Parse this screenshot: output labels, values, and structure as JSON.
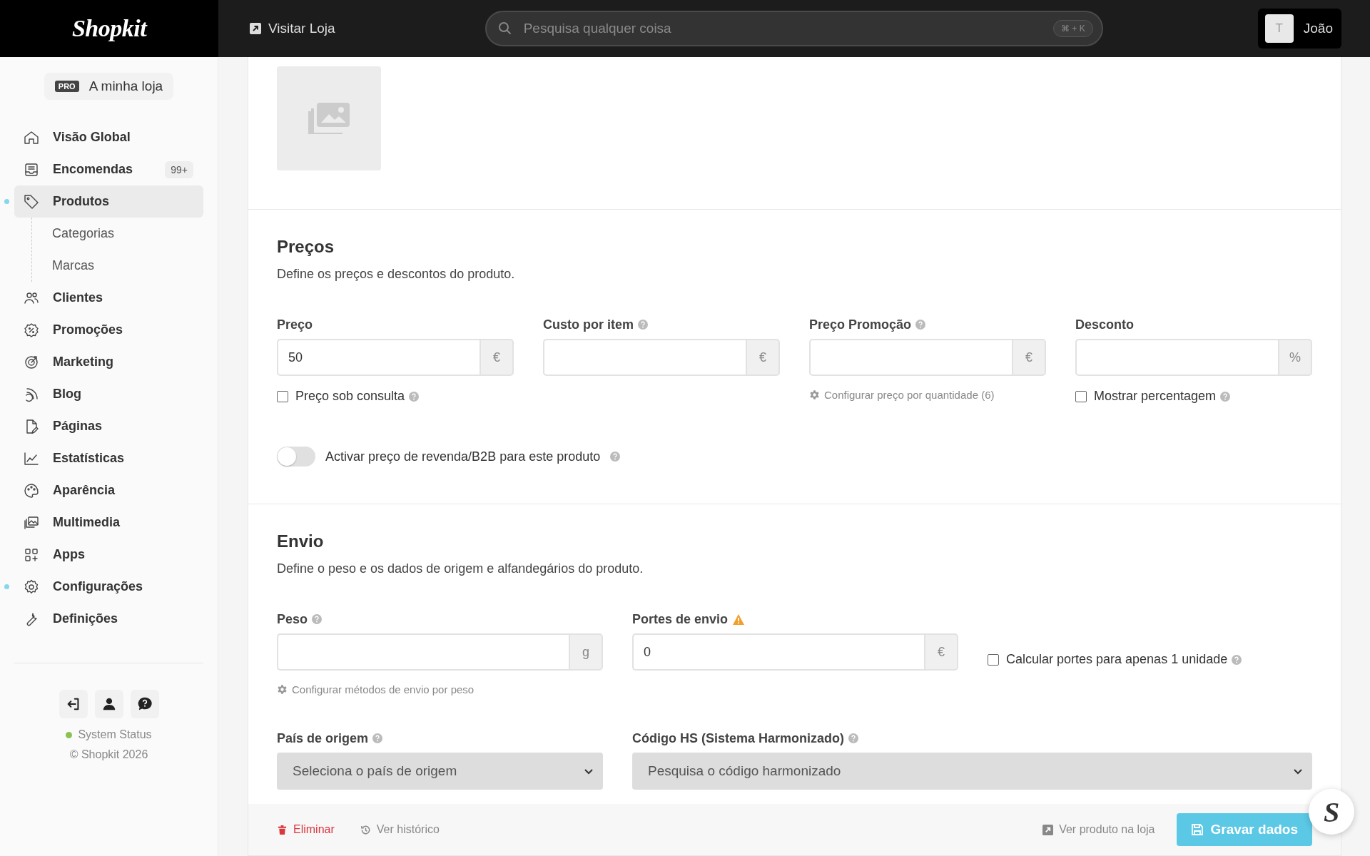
{
  "topbar": {
    "logo": "Shopkit",
    "visit_link": "Visitar Loja",
    "search": {
      "placeholder": "Pesquisa qualquer coisa",
      "shortcut": "⌘ + K"
    },
    "user": {
      "initial": "T",
      "name": "João"
    }
  },
  "sidebar": {
    "store": {
      "badge": "PRO",
      "name": "A minha loja"
    },
    "items": [
      {
        "label": "Visão Global",
        "selected": false,
        "dot": false
      },
      {
        "label": "Encomendas",
        "selected": false,
        "dot": false,
        "badge": "99+"
      },
      {
        "label": "Produtos",
        "selected": true,
        "dot": true,
        "children": [
          {
            "label": "Categorias",
            "selected": false
          },
          {
            "label": "Marcas",
            "selected": false
          }
        ]
      },
      {
        "label": "Clientes",
        "selected": false,
        "dot": false
      },
      {
        "label": "Promoções",
        "selected": false,
        "dot": false
      },
      {
        "label": "Marketing",
        "selected": false,
        "dot": false
      },
      {
        "label": "Blog",
        "selected": false,
        "dot": false
      },
      {
        "label": "Páginas",
        "selected": false,
        "dot": false
      },
      {
        "label": "Estatísticas",
        "selected": false,
        "dot": false
      },
      {
        "label": "Aparência",
        "selected": false,
        "dot": false
      },
      {
        "label": "Multimedia",
        "selected": false,
        "dot": false
      },
      {
        "label": "Apps",
        "selected": false,
        "dot": false
      },
      {
        "label": "Configurações",
        "selected": false,
        "dot": true
      },
      {
        "label": "Definições",
        "selected": false,
        "dot": false
      }
    ],
    "status": {
      "label": "System Status",
      "color": "#8cc152"
    },
    "copyright": "© Shopkit 2026"
  },
  "pricing": {
    "title": "Preços",
    "description": "Define os preços e descontos do produto.",
    "fields": [
      {
        "label": "Preço",
        "help": false,
        "value": "50",
        "unit": "€",
        "extra": {
          "kind": "checkbox",
          "label": "Preço sob consulta",
          "checked": false,
          "help": true
        }
      },
      {
        "label": "Custo por item",
        "help": true,
        "unit": "€"
      },
      {
        "label": "Preço Promoção",
        "help": true,
        "unit": "€",
        "extra": {
          "kind": "link",
          "label": "Configurar preço por quantidade (6)"
        }
      },
      {
        "label": "Desconto",
        "help": false,
        "unit": "%",
        "extra": {
          "kind": "checkbox",
          "label": "Mostrar percentagem",
          "checked": false,
          "help": true
        }
      }
    ],
    "toggle": {
      "label": "Activar preço de revenda/B2B para este produto",
      "on": false,
      "help": true
    }
  },
  "shipping": {
    "title": "Envio",
    "description": "Define o peso e os dados de origem e alfandegários do produto.",
    "fields": [
      {
        "label": "Peso",
        "help": true,
        "warning": false,
        "unit": "g",
        "extra": {
          "kind": "link",
          "label": "Configurar métodos de envio por peso"
        }
      },
      {
        "label": "Portes de envio",
        "help": false,
        "warning": true,
        "value": "0",
        "unit": "€"
      }
    ],
    "checkbox": {
      "label": "Calcular portes para apenas 1 unidade",
      "checked": false,
      "help": true
    },
    "selects": [
      {
        "label": "País de origem",
        "help": true,
        "placeholder": "Seleciona o país de origem"
      },
      {
        "label": "Código HS (Sistema Harmonizado)",
        "help": true,
        "placeholder": "Pesquisa o código harmonizado"
      }
    ]
  },
  "footer": {
    "delete": "Eliminar",
    "history": "Ver histórico",
    "view": "Ver produto na loja",
    "save": "Gravar dados"
  },
  "chat_widget": {
    "logo": "S"
  }
}
